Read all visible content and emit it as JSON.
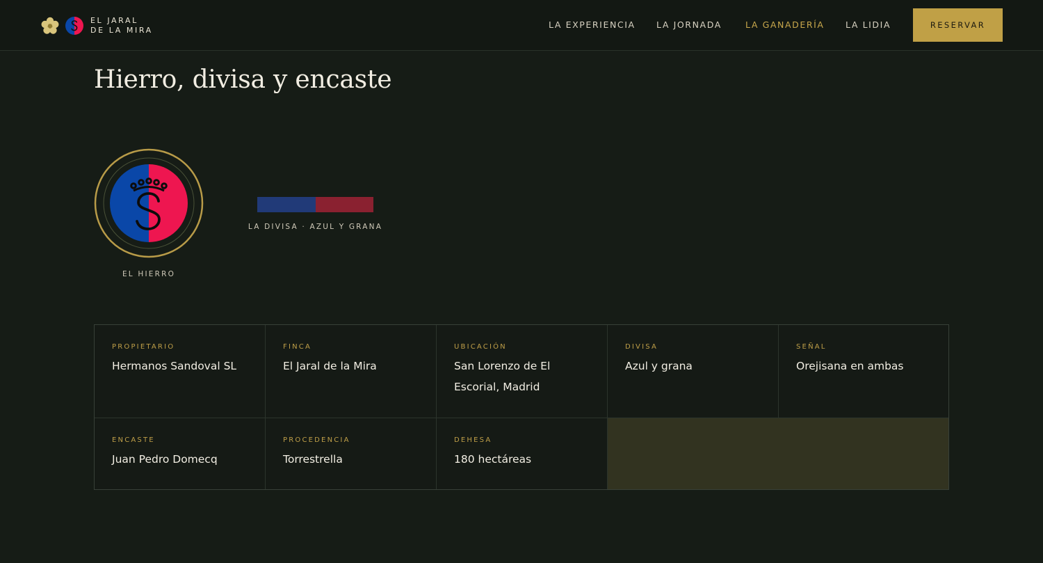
{
  "brand": {
    "line1": "EL JARAL",
    "line2": "DE LA MIRA"
  },
  "nav": [
    {
      "label": "LA EXPERIENCIA",
      "active": false
    },
    {
      "label": "LA JORNADA",
      "active": false
    },
    {
      "label": "LA GANADERÍA",
      "active": true
    },
    {
      "label": "LA LIDIA",
      "active": false
    }
  ],
  "cta": {
    "label": "RESERVAR"
  },
  "page_title": "Hierro, divisa y encaste",
  "hierro": {
    "label": "EL HIERRO",
    "letter": "S"
  },
  "divisa": {
    "label": "LA DIVISA · AZUL Y GRANA"
  },
  "colors": {
    "gold": "#c0a046",
    "divisa_blue": "#213a78",
    "divisa_red": "#8a2130",
    "seal_blue": "#0a47a8",
    "seal_red": "#ee1650"
  },
  "facts": [
    {
      "label": "PROPIETARIO",
      "value": "Hermanos Sandoval SL"
    },
    {
      "label": "FINCA",
      "value": "El Jaral de la Mira"
    },
    {
      "label": "UBICACIÓN",
      "value": "San Lorenzo de El Escorial, Madrid"
    },
    {
      "label": "DIVISA",
      "value": "Azul y grana"
    },
    {
      "label": "SEÑAL",
      "value": "Orejisana en ambas"
    },
    {
      "label": "ENCASTE",
      "value": "Juan Pedro Domecq"
    },
    {
      "label": "PROCEDENCIA",
      "value": "Torrestrella"
    },
    {
      "label": "DEHESA",
      "value": "180 hectáreas"
    }
  ]
}
